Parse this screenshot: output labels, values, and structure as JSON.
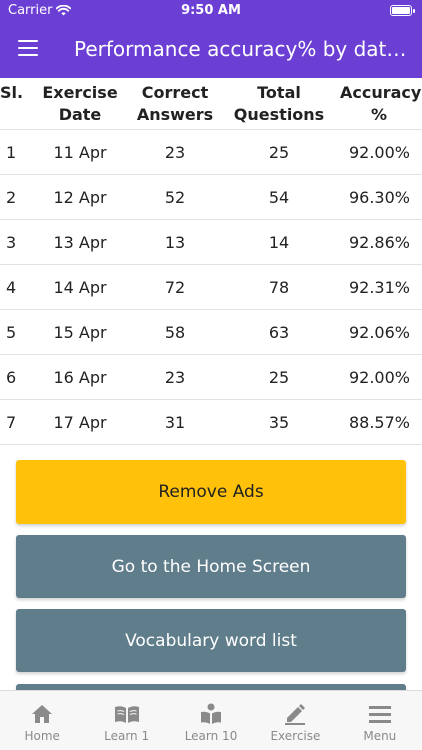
{
  "status_bar": {
    "carrier": "Carrier",
    "time": "9:50 AM"
  },
  "app_bar": {
    "title": "Performance accuracy% by date ..."
  },
  "table": {
    "headers": {
      "sl": "Sl.",
      "date_line1": "Exercise",
      "date_line2": "Date",
      "correct_line1": "Correct",
      "correct_line2": "Answers",
      "total_line1": "Total",
      "total_line2": "Questions",
      "acc_line1": "Accuracy",
      "acc_line2": "%"
    },
    "rows": [
      {
        "sl": "1",
        "date": "11 Apr",
        "correct": "23",
        "total": "25",
        "accuracy": "92.00%"
      },
      {
        "sl": "2",
        "date": "12 Apr",
        "correct": "52",
        "total": "54",
        "accuracy": "96.30%"
      },
      {
        "sl": "3",
        "date": "13 Apr",
        "correct": "13",
        "total": "14",
        "accuracy": "92.86%"
      },
      {
        "sl": "4",
        "date": "14 Apr",
        "correct": "72",
        "total": "78",
        "accuracy": "92.31%"
      },
      {
        "sl": "5",
        "date": "15 Apr",
        "correct": "58",
        "total": "63",
        "accuracy": "92.06%"
      },
      {
        "sl": "6",
        "date": "16 Apr",
        "correct": "23",
        "total": "25",
        "accuracy": "92.00%"
      },
      {
        "sl": "7",
        "date": "17 Apr",
        "correct": "31",
        "total": "35",
        "accuracy": "88.57%"
      }
    ]
  },
  "buttons": {
    "remove_ads": "Remove Ads",
    "home_screen": "Go to the Home Screen",
    "vocab_list": "Vocabulary word list"
  },
  "bottom_nav": {
    "items": [
      {
        "label": "Home",
        "icon": "home-icon"
      },
      {
        "label": "Learn 1",
        "icon": "book-open-icon"
      },
      {
        "label": "Learn 10",
        "icon": "reader-icon"
      },
      {
        "label": "Exercise",
        "icon": "pencil-icon"
      },
      {
        "label": "Menu",
        "icon": "menu-icon"
      }
    ]
  },
  "colors": {
    "primary": "#6c3fd4",
    "ads_button": "#ffc10a",
    "secondary_button": "#607d8b",
    "nav_icon": "#8a8a8a"
  }
}
